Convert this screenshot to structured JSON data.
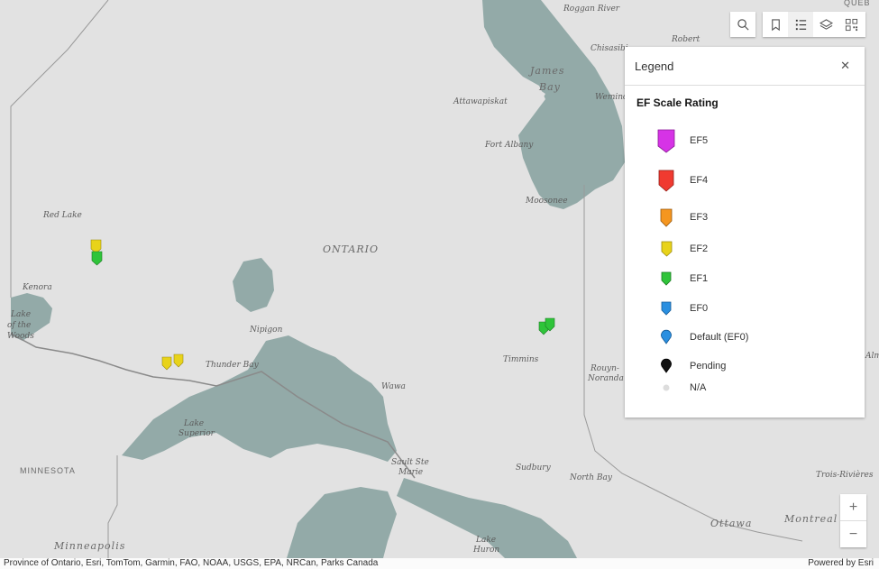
{
  "map": {
    "labels": {
      "roggan_river": "Roggan River",
      "chisasibi": "Chisasibi",
      "robert": "Robert",
      "james_bay_1": "James",
      "james_bay_2": "Bay",
      "wemindji": "Wemind",
      "attawapiskat": "Attawapiskat",
      "fort_albany": "Fort Albany",
      "moosonee": "Moosonee",
      "red_lake": "Red Lake",
      "ontario": "ONTARIO",
      "kenora": "Kenora",
      "lake_woods_1": "Lake",
      "lake_woods_2": "of the",
      "lake_woods_3": "Woods",
      "nipigon": "Nipigon",
      "thunder_bay": "Thunder Bay",
      "timmins": "Timmins",
      "rouyn_1": "Rouyn-",
      "rouyn_2": "Noranda",
      "wawa": "Wawa",
      "lake_superior_1": "Lake",
      "lake_superior_2": "Superior",
      "minnesota": "MINNESOTA",
      "sault_1": "Sault Ste",
      "sault_2": "Marie",
      "sudbury": "Sudbury",
      "north_bay": "North Bay",
      "trois_rivieres": "Trois-Rivières",
      "montreal": "Montreal",
      "ottawa": "Ottawa",
      "minneapolis": "Minneapolis",
      "lake_huron_1": "Lake",
      "lake_huron_2": "Huron",
      "alma": "Alm",
      "quebec": "QUÉB"
    },
    "colors": {
      "land": "#e2e2e2",
      "water": "#93aaa8",
      "border": "#9a9a9a"
    }
  },
  "toolbar": {
    "search_icon": "search-icon",
    "bookmark_icon": "bookmark-icon",
    "legend_icon": "list-icon",
    "layers_icon": "layers-icon",
    "qr_icon": "qr-code-icon"
  },
  "legend": {
    "title": "Legend",
    "close_label": "✕",
    "group_title": "EF Scale Rating",
    "items": [
      {
        "label": "EF5",
        "color": "#d633e6"
      },
      {
        "label": "EF4",
        "color": "#f03a30"
      },
      {
        "label": "EF3",
        "color": "#f5961f"
      },
      {
        "label": "EF2",
        "color": "#e8d31a"
      },
      {
        "label": "EF1",
        "color": "#2fc43a"
      },
      {
        "label": "EF0",
        "color": "#2a8fe0"
      },
      {
        "label": "Default (EF0)",
        "color": "#2a8fe0"
      },
      {
        "label": "Pending",
        "color": "#111111"
      },
      {
        "label": "N/A",
        "color": "#dddddd"
      }
    ]
  },
  "zoom": {
    "in_label": "+",
    "out_label": "−"
  },
  "attribution": {
    "sources": "Province of Ontario, Esri, TomTom, Garmin, FAO, NOAA, USGS, EPA, NRCan, Parks Canada",
    "powered_by": "Powered by Esri"
  }
}
